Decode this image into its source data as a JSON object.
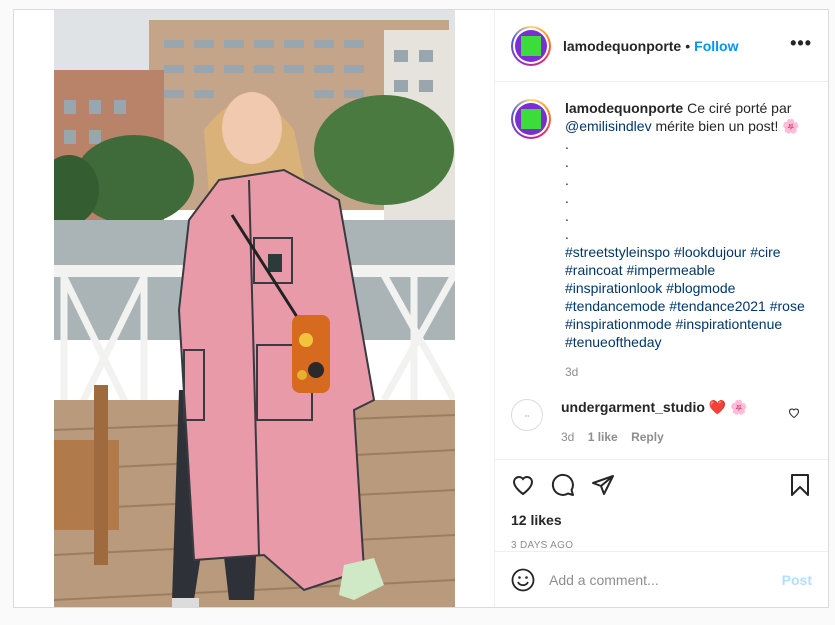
{
  "header": {
    "username": "lamodequonporte",
    "separator": "•",
    "follow_label": "Follow",
    "more_label": "•••"
  },
  "caption": {
    "username": "lamodequonporte",
    "text_before": "Ce ciré porté par",
    "mention": "@emilisindlev",
    "text_after": "mérite bien un post!",
    "emoji": "🌸",
    "dots": [
      ".",
      ".",
      ".",
      ".",
      ".",
      "."
    ],
    "hashtags": "#streetstyleinspo #lookdujour #cire #raincoat #impermeable #inspirationlook #blogmode #tendancemode #tendance2021 #rose #inspirationmode #inspirationtenue #tenueoftheday",
    "time": "3d"
  },
  "comment": {
    "username": "undergarment_studio",
    "emoji": "❤️ 🌸",
    "time": "3d",
    "likes": "1 like",
    "reply_label": "Reply"
  },
  "actions": {
    "likes": "12 likes",
    "time_ago": "3 DAYS AGO"
  },
  "add_comment": {
    "placeholder": "Add a comment...",
    "post_label": "Post"
  },
  "colors": {
    "accent": "#0095f6",
    "post_disabled": "#b2dffc",
    "avatar_bg": "#7b2fd0",
    "avatar_square": "#3ddc3d",
    "coat": "#e89aa8"
  }
}
